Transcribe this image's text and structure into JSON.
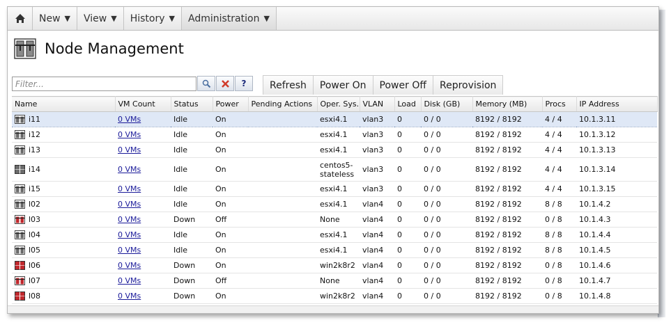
{
  "nav": {
    "items": [
      {
        "label": "New",
        "arrow": "▼"
      },
      {
        "label": "View",
        "arrow": "▼"
      },
      {
        "label": "History",
        "arrow": "▼"
      },
      {
        "label": "Administration",
        "arrow": "▼"
      }
    ]
  },
  "page": {
    "title": "Node Management"
  },
  "filter": {
    "placeholder": "Filter...",
    "search_icon": "search-icon",
    "clear_icon": "close-icon",
    "help_label": "?"
  },
  "toolbar": {
    "refresh": "Refresh",
    "power_on": "Power On",
    "power_off": "Power Off",
    "reprovision": "Reprovision"
  },
  "table": {
    "columns": [
      "Name",
      "VM Count",
      "Status",
      "Power",
      "Pending Actions",
      "Oper. Sys.",
      "VLAN",
      "Load",
      "Disk (GB)",
      "Memory (MB)",
      "Procs",
      "IP Address"
    ],
    "rows": [
      {
        "name": "i11",
        "vms": "0 VMs",
        "status": "Idle",
        "power": "On",
        "pending": "",
        "os": "esxi4.1",
        "vlan": "vlan3",
        "load": "0",
        "disk": "0 / 0",
        "memory": "8192 / 8192",
        "procs": "4 / 4",
        "ip": "10.1.3.11",
        "icon": "gray",
        "selected": true
      },
      {
        "name": "i12",
        "vms": "0 VMs",
        "status": "Idle",
        "power": "On",
        "pending": "",
        "os": "esxi4.1",
        "vlan": "vlan3",
        "load": "0",
        "disk": "0 / 0",
        "memory": "8192 / 8192",
        "procs": "4 / 4",
        "ip": "10.1.3.12",
        "icon": "gray"
      },
      {
        "name": "i13",
        "vms": "0 VMs",
        "status": "Idle",
        "power": "On",
        "pending": "",
        "os": "esxi4.1",
        "vlan": "vlan3",
        "load": "0",
        "disk": "0 / 0",
        "memory": "8192 / 8192",
        "procs": "4 / 4",
        "ip": "10.1.3.13",
        "icon": "gray"
      },
      {
        "name": "i14",
        "vms": "0 VMs",
        "status": "Idle",
        "power": "On",
        "pending": "",
        "os": "centos5-stateless",
        "vlan": "vlan3",
        "load": "0",
        "disk": "0 / 0",
        "memory": "8192 / 8192",
        "procs": "4 / 4",
        "ip": "10.1.3.14",
        "icon": "gray-solid",
        "tall": true
      },
      {
        "name": "i15",
        "vms": "0 VMs",
        "status": "Idle",
        "power": "On",
        "pending": "",
        "os": "esxi4.1",
        "vlan": "vlan3",
        "load": "0",
        "disk": "0 / 0",
        "memory": "8192 / 8192",
        "procs": "4 / 4",
        "ip": "10.1.3.15",
        "icon": "gray"
      },
      {
        "name": "l02",
        "vms": "0 VMs",
        "status": "Idle",
        "power": "On",
        "pending": "",
        "os": "esxi4.1",
        "vlan": "vlan4",
        "load": "0",
        "disk": "0 / 0",
        "memory": "8192 / 8192",
        "procs": "8 / 8",
        "ip": "10.1.4.2",
        "icon": "gray"
      },
      {
        "name": "l03",
        "vms": "0 VMs",
        "status": "Down",
        "power": "Off",
        "pending": "",
        "os": "None",
        "vlan": "vlan4",
        "load": "0",
        "disk": "0 / 0",
        "memory": "8192 / 8192",
        "procs": "0 / 8",
        "ip": "10.1.4.3",
        "icon": "red"
      },
      {
        "name": "l04",
        "vms": "0 VMs",
        "status": "Idle",
        "power": "On",
        "pending": "",
        "os": "esxi4.1",
        "vlan": "vlan4",
        "load": "0",
        "disk": "0 / 0",
        "memory": "8192 / 8192",
        "procs": "8 / 8",
        "ip": "10.1.4.4",
        "icon": "gray"
      },
      {
        "name": "l05",
        "vms": "0 VMs",
        "status": "Idle",
        "power": "On",
        "pending": "",
        "os": "esxi4.1",
        "vlan": "vlan4",
        "load": "0",
        "disk": "0 / 0",
        "memory": "8192 / 8192",
        "procs": "8 / 8",
        "ip": "10.1.4.5",
        "icon": "gray"
      },
      {
        "name": "l06",
        "vms": "0 VMs",
        "status": "Down",
        "power": "On",
        "pending": "",
        "os": "win2k8r2",
        "vlan": "vlan4",
        "load": "0",
        "disk": "0 / 0",
        "memory": "8192 / 8192",
        "procs": "0 / 8",
        "ip": "10.1.4.6",
        "icon": "red-solid"
      },
      {
        "name": "l07",
        "vms": "0 VMs",
        "status": "Down",
        "power": "Off",
        "pending": "",
        "os": "None",
        "vlan": "vlan4",
        "load": "0",
        "disk": "0 / 0",
        "memory": "8192 / 8192",
        "procs": "0 / 8",
        "ip": "10.1.4.7",
        "icon": "red"
      },
      {
        "name": "l08",
        "vms": "0 VMs",
        "status": "Down",
        "power": "On",
        "pending": "",
        "os": "win2k8r2",
        "vlan": "vlan4",
        "load": "0",
        "disk": "0 / 0",
        "memory": "8192 / 8192",
        "procs": "0 / 8",
        "ip": "10.1.4.8",
        "icon": "red-solid"
      }
    ]
  },
  "colors": {
    "selected_row": "#dfe8f6",
    "link": "#1a1a99",
    "node_gray": "#6b6b6b",
    "node_red": "#c0282d"
  }
}
